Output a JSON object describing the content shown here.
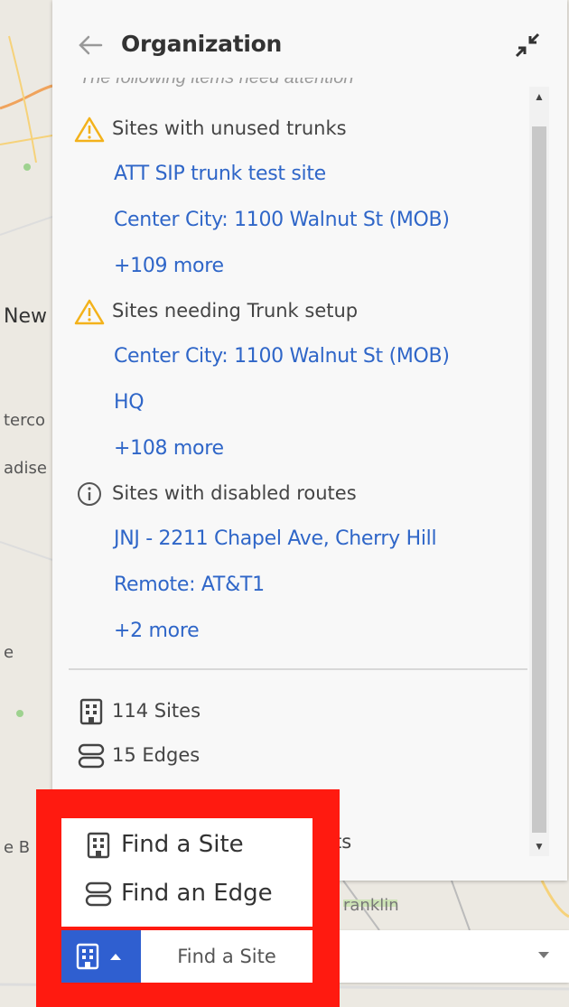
{
  "panel": {
    "title": "Organization",
    "back_icon": "arrow-left-icon",
    "collapse_icon": "collapse-arrows-icon",
    "partial_text": "The following items need attention"
  },
  "attention": [
    {
      "icon": "warning-icon",
      "heading": "Sites with unused trunks",
      "links": [
        "ATT SIP trunk test site",
        "Center City: 1100 Walnut St (MOB)",
        "+109 more"
      ]
    },
    {
      "icon": "warning-icon",
      "heading": "Sites needing Trunk setup",
      "links": [
        "Center City: 1100 Walnut St (MOB)",
        "HQ",
        "+108 more"
      ]
    },
    {
      "icon": "info-icon",
      "heading": "Sites with disabled routes",
      "links": [
        "JNJ - 2211 Chapel Ave, Cherry Hill",
        "Remote: AT&T1",
        "+2 more"
      ]
    }
  ],
  "stats": [
    {
      "icon": "building-icon",
      "label": "114 Sites"
    },
    {
      "icon": "server-icon",
      "label": "15 Edges"
    }
  ],
  "stats_partial": "ts",
  "map_labels": {
    "l1": "New",
    "l2": "terco",
    "l3": "adise",
    "l4": "e",
    "l5": "e B",
    "l6": "ranklin"
  },
  "popup": {
    "items": [
      {
        "icon": "building-icon",
        "label": "Find a Site"
      },
      {
        "icon": "server-icon",
        "label": "Find an Edge"
      }
    ]
  },
  "search": {
    "type_icon": "building-icon",
    "selected_label": "Find a Site"
  },
  "colors": {
    "link": "#2f66c8",
    "warning": "#f3b21b",
    "highlight": "#ff1a10",
    "type_button": "#2f5fd0"
  }
}
